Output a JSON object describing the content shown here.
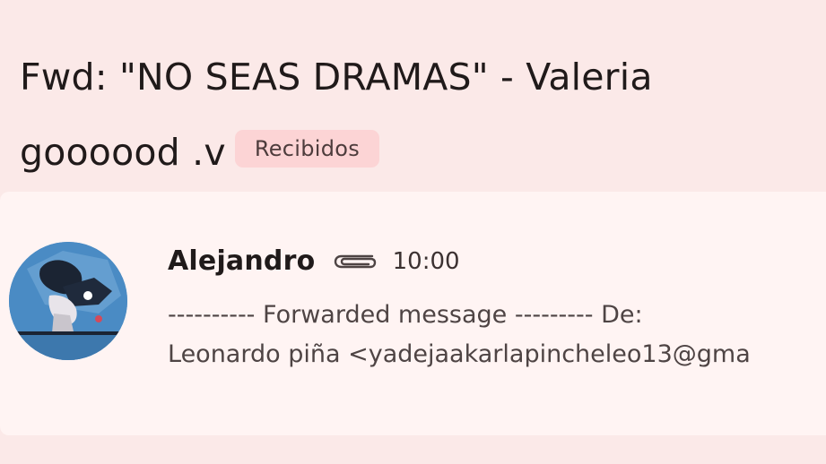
{
  "subject": {
    "line1": "Fwd: \"NO SEAS DRAMAS\" - Valeria",
    "line2": "goooood .v",
    "label": "Recibidos"
  },
  "message": {
    "sender": "Alejandro",
    "attachment_icon": "paperclip-icon",
    "time": "10:00",
    "snippet_line1": "---------- Forwarded message --------- De:",
    "snippet_line2": "Leonardo piña <yadejaakarlapincheleo13@gma"
  },
  "colors": {
    "background": "#fbe9e8",
    "card": "#fff4f3",
    "label_chip": "#fcd4d5",
    "avatar_bg": "#4a8bc4"
  }
}
